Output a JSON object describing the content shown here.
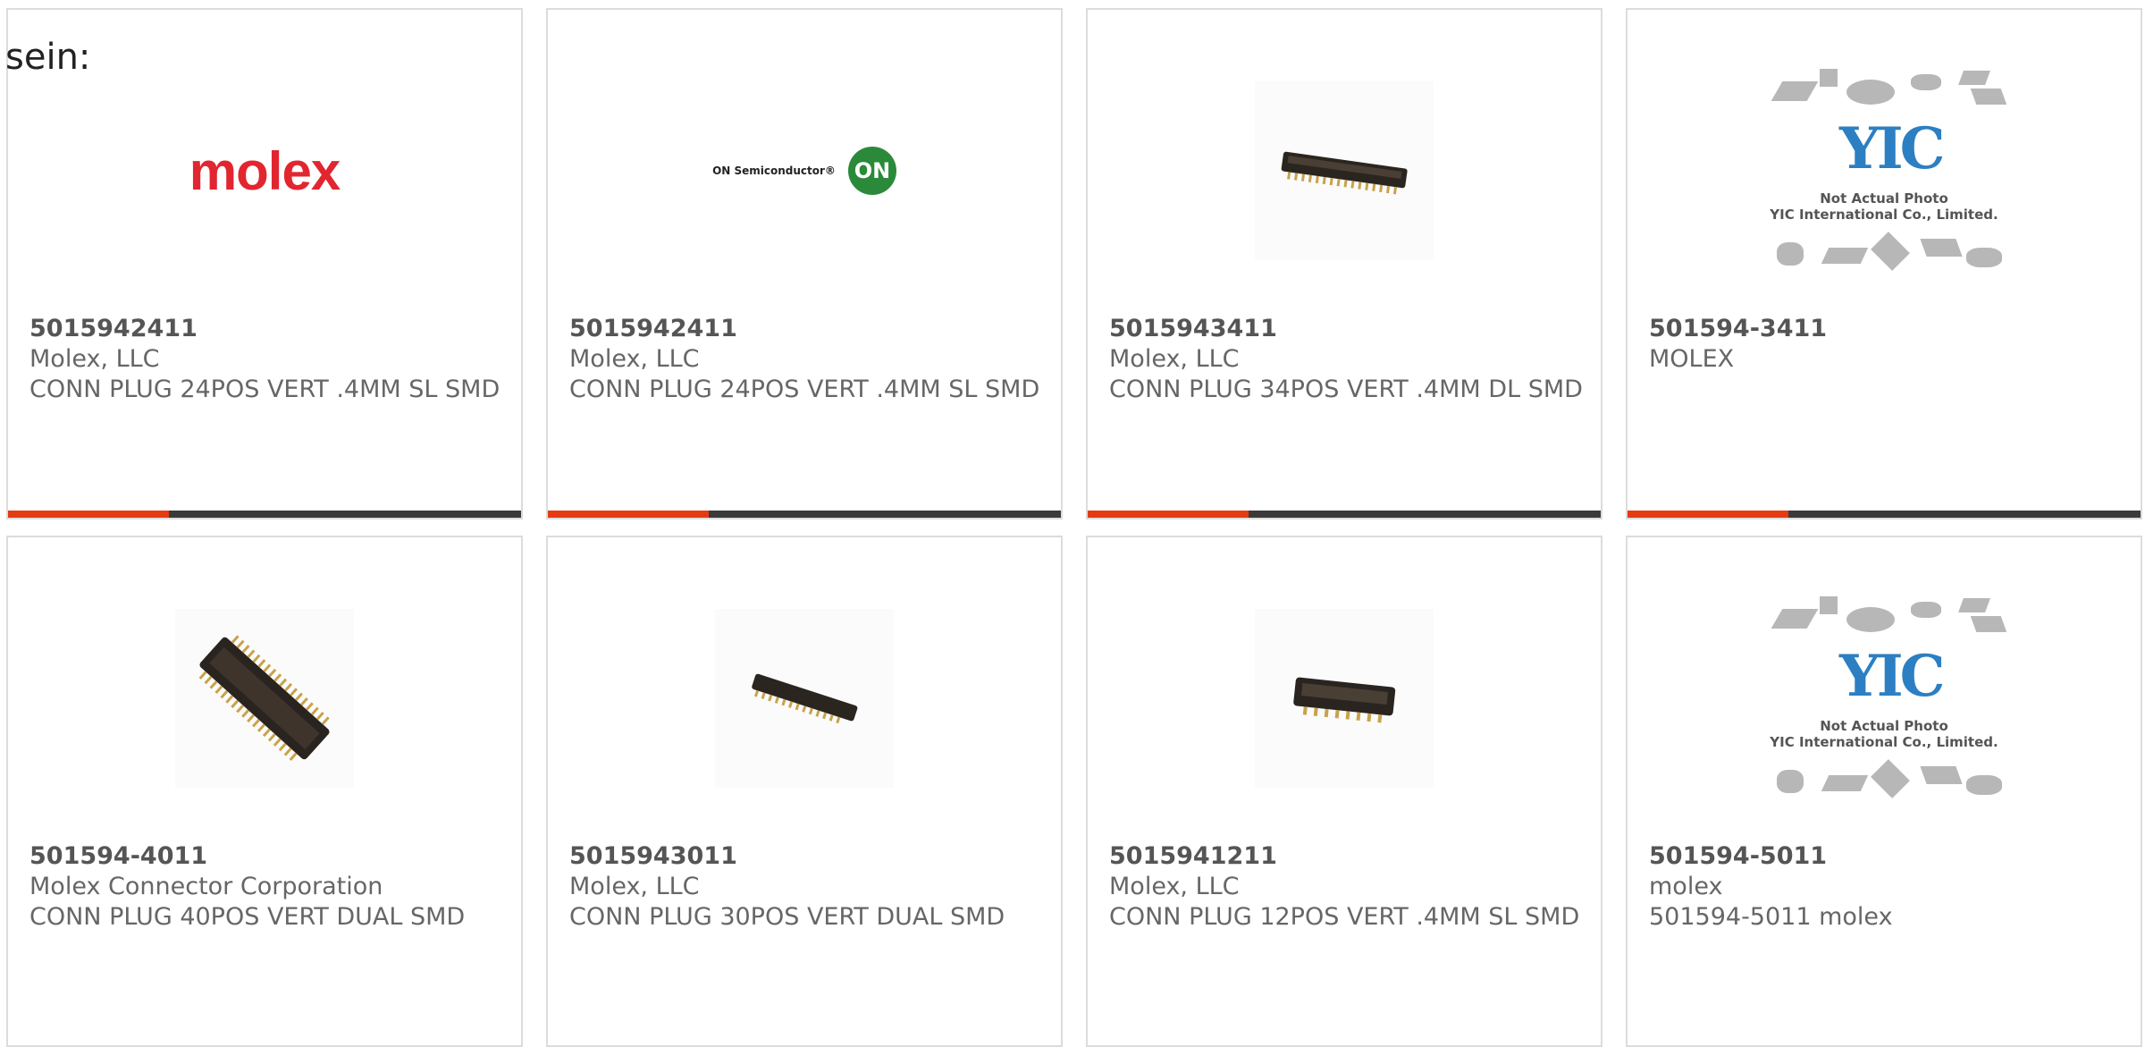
{
  "heading": "sein:",
  "cards": [
    {
      "part": "5015942411",
      "maker": "Molex, LLC",
      "desc": "CONN PLUG 24POS VERT .4MM SL SMD",
      "image": "molex-logo"
    },
    {
      "part": "5015942411",
      "maker": "Molex, LLC",
      "desc": "CONN PLUG 24POS VERT .4MM SL SMD",
      "image": "on-semiconductor-logo"
    },
    {
      "part": "5015943411",
      "maker": "Molex, LLC",
      "desc": "CONN PLUG 34POS VERT .4MM DL SMD",
      "image": "connector-photo"
    },
    {
      "part": "501594-3411",
      "maker": "MOLEX",
      "desc": "",
      "image": "yic-placeholder"
    },
    {
      "part": "501594-4011",
      "maker": "Molex Connector Corporation",
      "desc": "CONN PLUG 40POS VERT DUAL SMD",
      "image": "connector-photo"
    },
    {
      "part": "5015943011",
      "maker": "Molex, LLC",
      "desc": "CONN PLUG 30POS VERT DUAL SMD",
      "image": "connector-photo"
    },
    {
      "part": "5015941211",
      "maker": "Molex, LLC",
      "desc": "CONN PLUG 12POS VERT .4MM SL SMD",
      "image": "connector-photo"
    },
    {
      "part": "501594-5011",
      "maker": "molex",
      "desc": "501594-5011 molex",
      "image": "yic-placeholder"
    }
  ],
  "logos": {
    "molex": "molex",
    "on_text": "ON Semiconductor®",
    "on_mark": "ON",
    "yic_mark": "YIC",
    "yic_caption_1": "Not Actual Photo",
    "yic_caption_2": "YIC International Co., Limited."
  },
  "colors": {
    "accent": "#e43b12",
    "bar": "#3a3a3a",
    "border": "#dcdcdc"
  }
}
